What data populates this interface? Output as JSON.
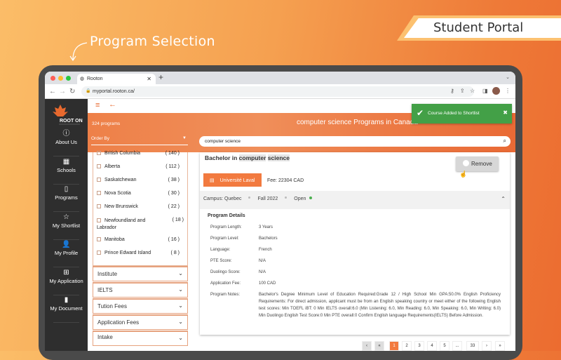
{
  "hero": {
    "label": "Program Selection",
    "badge": "Student Portal"
  },
  "browser": {
    "tab_title": "Rooton",
    "url": "myportal.rooton.ca/"
  },
  "sidebar": {
    "logo_text": "ROOT ON",
    "items": [
      {
        "label": "About Us",
        "icon": "info-icon"
      },
      {
        "label": "Schools",
        "icon": "building-icon"
      },
      {
        "label": "Programs",
        "icon": "book-icon"
      },
      {
        "label": "My Shortlist",
        "icon": "star-icon"
      },
      {
        "label": "My Profile",
        "icon": "person-icon"
      },
      {
        "label": "My Application",
        "icon": "add-document-icon"
      },
      {
        "label": "My Document",
        "icon": "file-icon"
      }
    ]
  },
  "banner": {
    "count": "324 programs",
    "order_by": "Order By",
    "search_value": "computer science",
    "title": "computer science Programs in Canada"
  },
  "toast": {
    "message": "Course Added to Shortlist",
    "close": "✖"
  },
  "filters": {
    "provinces": [
      {
        "name": "British Columbia",
        "count": "( 140 )"
      },
      {
        "name": "Alberta",
        "count": "( 112 )"
      },
      {
        "name": "Saskatchewan",
        "count": "( 38 )"
      },
      {
        "name": "Nova Scotia",
        "count": "( 30 )"
      },
      {
        "name": "New Brunswick",
        "count": "( 22 )"
      },
      {
        "name": "Newfoundland and Labrador",
        "count": "( 18 )"
      },
      {
        "name": "Manitoba",
        "count": "( 16 )"
      },
      {
        "name": "Prince Edward Island",
        "count": "( 8 )"
      }
    ],
    "sections": [
      "Institute",
      "IELTS",
      "Tution Fees",
      "Application Fees",
      "Intake"
    ]
  },
  "program": {
    "title_prefix": "Bachelor in",
    "title_hl1": "computer",
    "title_hl2": "science",
    "remove": "Remove",
    "university": "Université Laval",
    "fee": "Fee: 22304 CAD",
    "campus": "Campus: Quebec",
    "intake": "Fall 2022",
    "status": "Open",
    "details_heading": "Program Details",
    "details": [
      {
        "label": "Program Length:",
        "value": "3 Years"
      },
      {
        "label": "Program Level:",
        "value": "Bachelors"
      },
      {
        "label": "Language:",
        "value": "French"
      },
      {
        "label": "PTE Score:",
        "value": "N/A"
      },
      {
        "label": "Duolingo Score:",
        "value": "N/A"
      },
      {
        "label": "Application Fee:",
        "value": "100 CAD"
      },
      {
        "label": "Program Notes:",
        "value": "Bachelor's Degree Minimum Level of Education Required:Grade 12 / High School Min GPA:50.0% English Proficiency Requirements: For direct admission, applicant must be from an English speaking country or meet either of the following English test scores: Min TOEFL iBT: 0 Min IELTS overall:6.0 (Min Listening: 6.0, Min Reading: 6.0, Min Speaking: 6.0, Min Writing: 6.0) Min Duolingo English Test Score:0 Min PTE overall:0 Confirm English language Requirements(IELTS) Before Admission."
      }
    ]
  },
  "pagination": {
    "pages": [
      "‹",
      "«",
      "1",
      "2",
      "3",
      "4",
      "5",
      "...",
      "33",
      "›",
      "»"
    ],
    "current": "1"
  },
  "colors": {
    "accent": "#f27a3f",
    "toast": "#43a047",
    "sidebar": "#2e2e2e"
  }
}
